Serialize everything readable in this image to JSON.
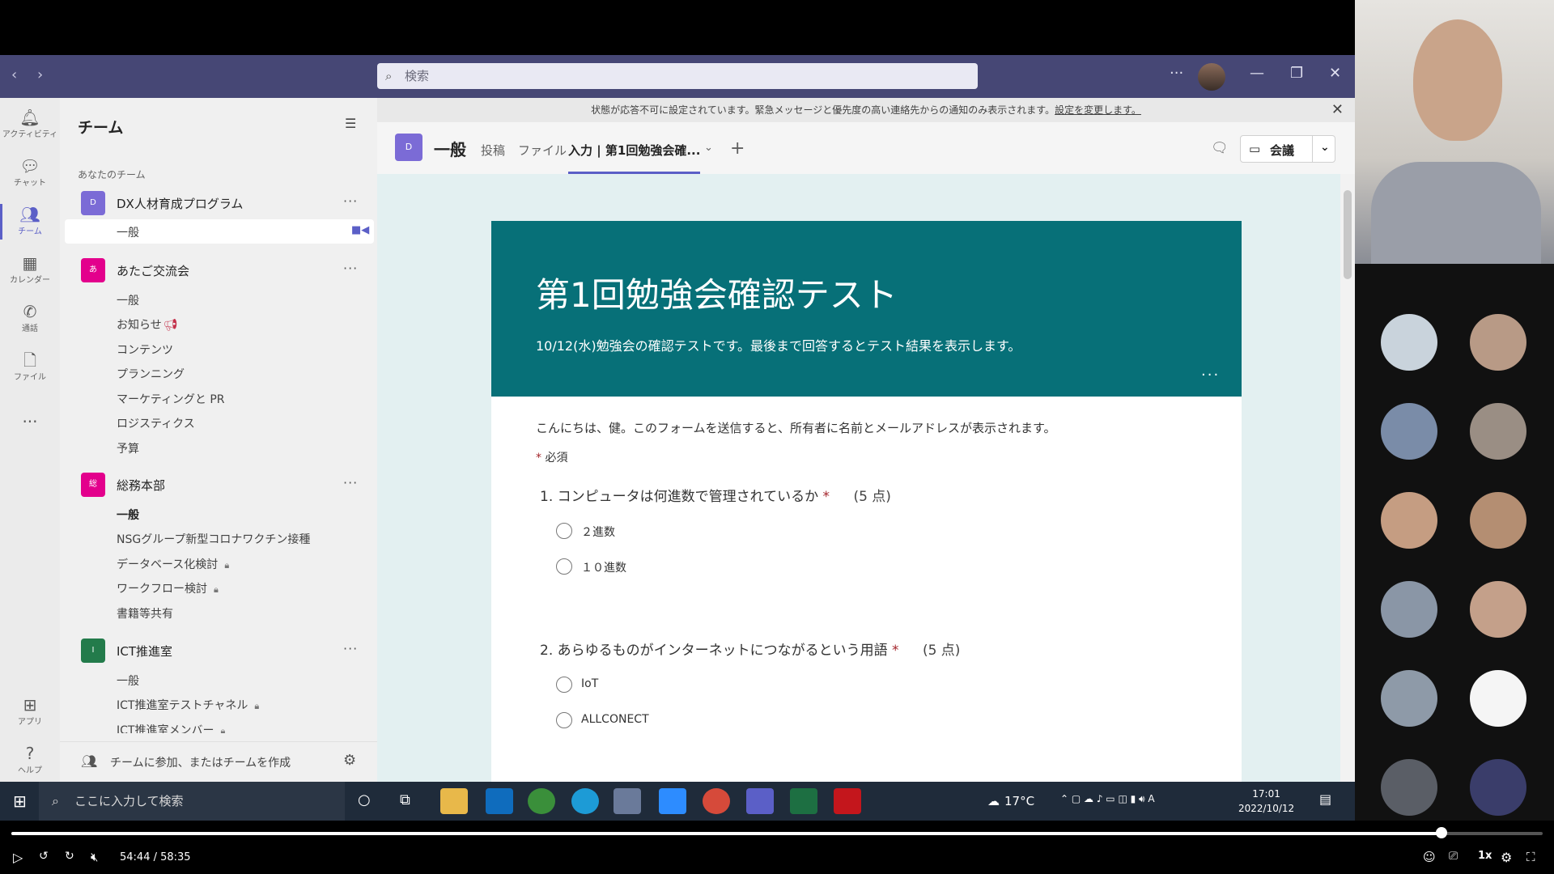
{
  "teams_window": {
    "search_placeholder": "検索",
    "titlebar_icons": [
      "back-icon",
      "forward-icon",
      "more-icon",
      "minimize-icon",
      "restore-icon",
      "close-icon"
    ]
  },
  "rail": [
    {
      "label": "アクティビティ",
      "icon": "bell-icon"
    },
    {
      "label": "チャット",
      "icon": "chat-icon"
    },
    {
      "label": "チーム",
      "icon": "teams-icon",
      "active": true
    },
    {
      "label": "カレンダー",
      "icon": "calendar-icon"
    },
    {
      "label": "通話",
      "icon": "phone-icon"
    },
    {
      "label": "ファイル",
      "icon": "file-icon"
    },
    {
      "label": "...",
      "icon": "more-icon"
    },
    {
      "label": "アプリ",
      "icon": "apps-icon"
    },
    {
      "label": "ヘルプ",
      "icon": "help-icon"
    }
  ],
  "sidebar": {
    "title": "チーム",
    "section_label": "あなたのチーム",
    "footer_text": "チームに参加、またはチームを作成",
    "teams": [
      {
        "initial": "D",
        "name": "DX人材育成プログラム",
        "color": "#7b6bd6",
        "channels": [
          "一般"
        ]
      },
      {
        "initial": "あ",
        "name": "あたご交流会",
        "color": "#e3008c",
        "channels": [
          "一般",
          "お知らせ",
          "コンテンツ",
          "プランニング",
          "マーケティングと PR",
          "ロジスティクス",
          "予算"
        ]
      },
      {
        "initial": "総",
        "name": "総務本部",
        "color": "#e3008c",
        "channels": [
          "一般",
          "NSGグループ新型コロナワクチン接種",
          "データベース化検討",
          "ワークフロー検討",
          "書籍等共有"
        ]
      },
      {
        "initial": "I",
        "name": "ICT推進室",
        "color": "#237b4b",
        "channels": [
          "一般",
          "ICT推進室テストチャネル",
          "ICT推進室メンバー"
        ]
      }
    ]
  },
  "banner": {
    "text": "状態が応答不可に設定されています。緊急メッセージと優先度の高い連絡先からの通知のみ表示されます。",
    "link": "設定を変更します。"
  },
  "channel_header": {
    "tile": "D",
    "name": "一般",
    "tabs": [
      "投稿",
      "ファイル",
      "入力 | 第1回勉強会確..."
    ],
    "meet_label": "会議"
  },
  "form": {
    "title": "第1回勉強会確認テスト",
    "description": "10/12(水)勉強会の確認テストです。最後まで回答するとテスト結果を表示します。",
    "notice": "こんにちは、健。このフォームを送信すると、所有者に名前とメールアドレスが表示されます。",
    "required_label": "必須",
    "questions": [
      {
        "text": "1. コンピュータは何進数で管理されているか",
        "points": "(5 点)",
        "options": [
          "２進数",
          "１０進数"
        ]
      },
      {
        "text": "2. あらゆるものがインターネットにつながるという用語",
        "points": "(5 点)",
        "options": [
          "IoT",
          "ALLCONECT"
        ]
      }
    ],
    "accent": "#077078"
  },
  "taskbar": {
    "search_placeholder": "ここに入力して検索",
    "weather": "17°C",
    "time": "17:01",
    "date": "2022/10/12"
  },
  "player": {
    "time": "54:44 / 58:35",
    "progress": 0.934,
    "speed": "1x"
  }
}
